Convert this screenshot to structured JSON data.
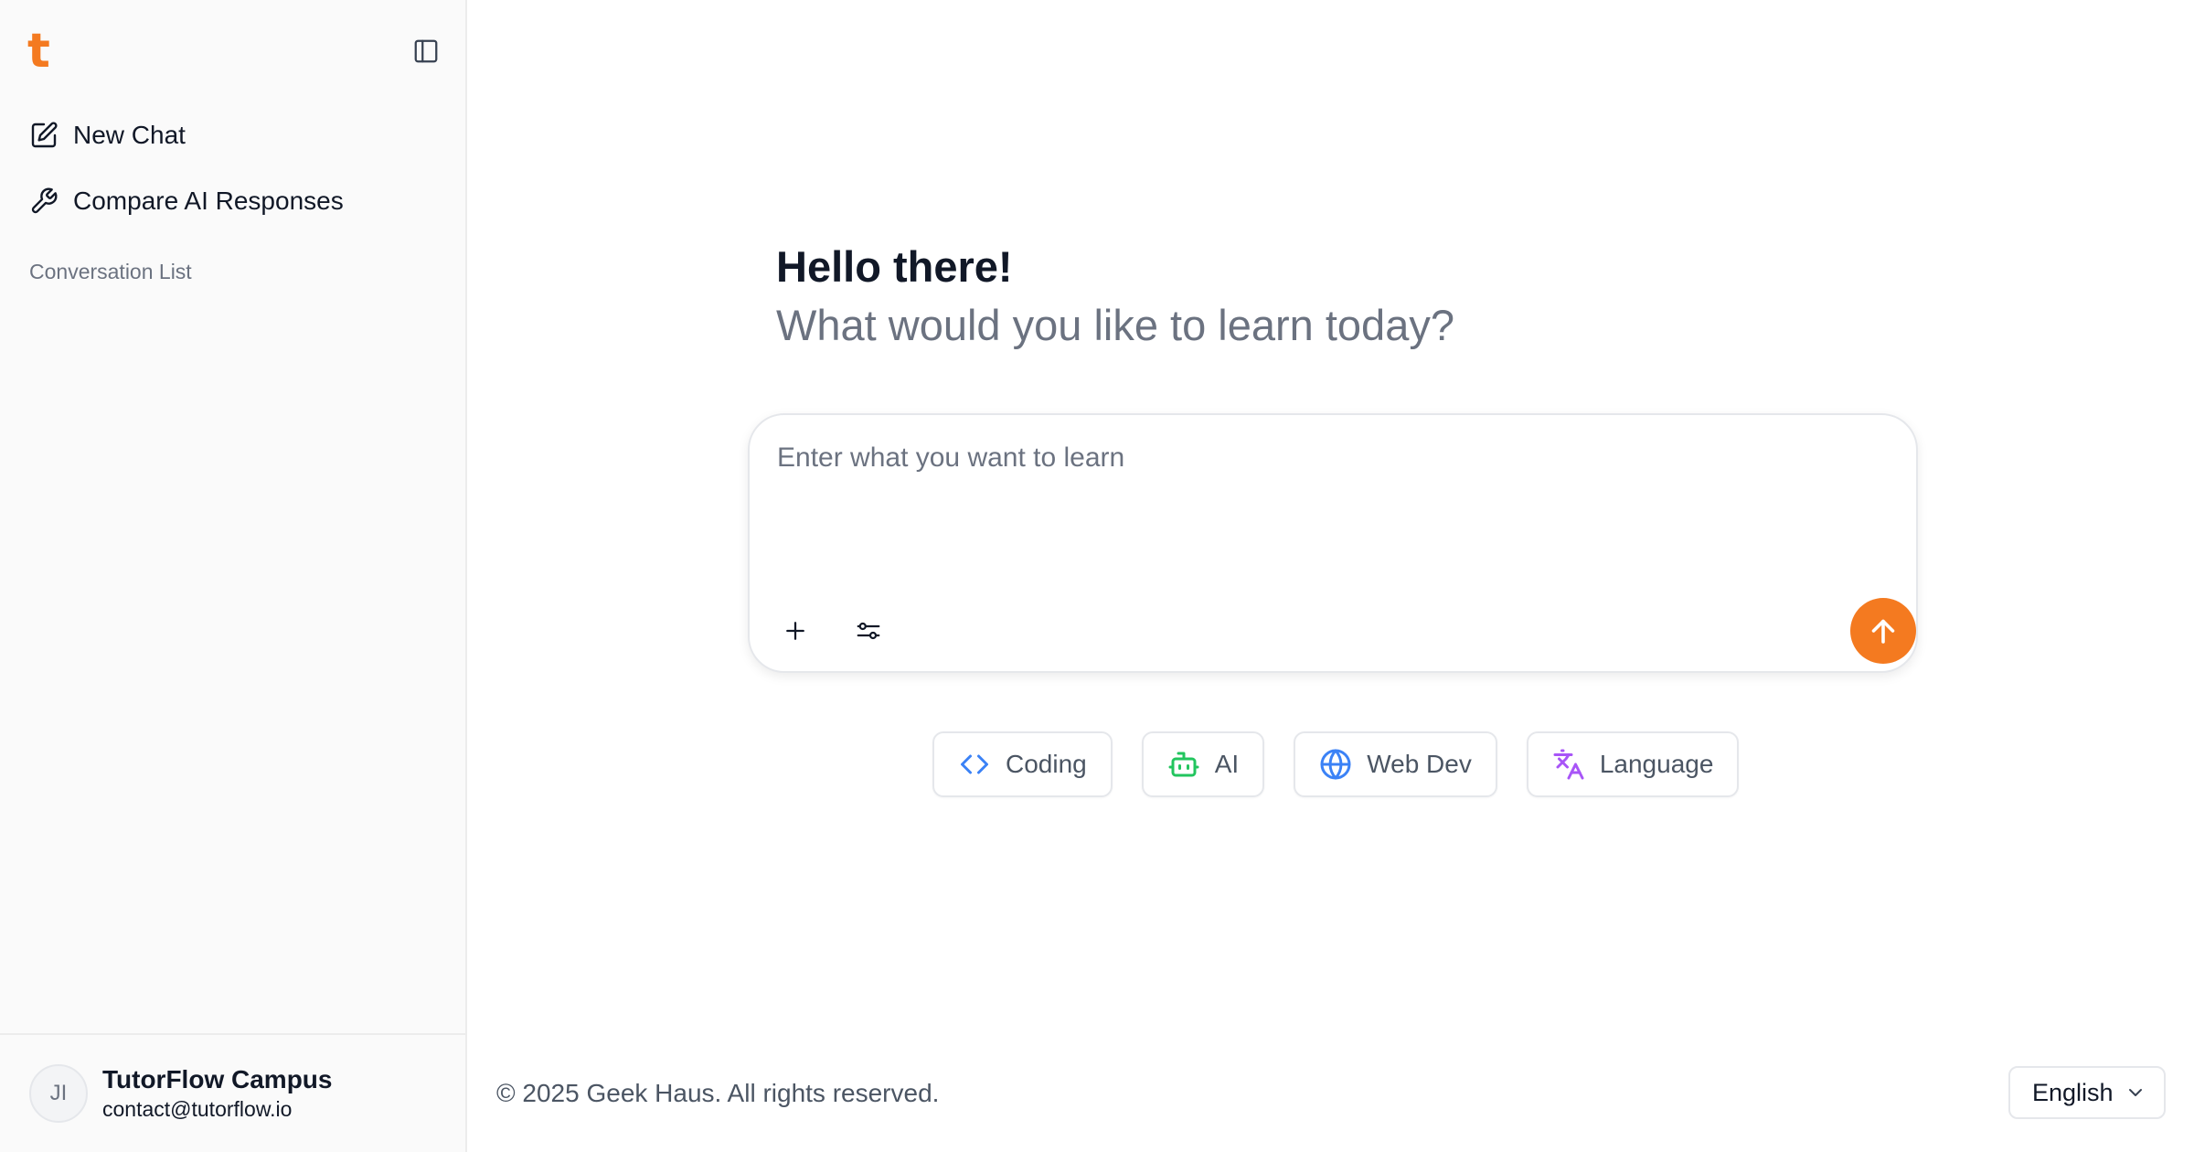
{
  "brand": {
    "logo_letter": "t",
    "accent_color": "#f47a20"
  },
  "sidebar": {
    "toggle_icon": "panel-left-icon",
    "nav": [
      {
        "label": "New Chat",
        "icon": "edit-icon"
      },
      {
        "label": "Compare AI Responses",
        "icon": "wrench-icon"
      }
    ],
    "section_label": "Conversation List",
    "user": {
      "initials": "JI",
      "name": "TutorFlow Campus",
      "email": "contact@tutorflow.io"
    }
  },
  "greeting": {
    "title": "Hello there!",
    "subtitle": "What would you like to learn today?"
  },
  "composer": {
    "placeholder": "Enter what you want to learn",
    "value": "",
    "attach_icon": "plus-icon",
    "settings_icon": "sliders-icon",
    "send_icon": "arrow-up-icon"
  },
  "chips": [
    {
      "label": "Coding",
      "icon": "code-icon",
      "color": "#3b82f6"
    },
    {
      "label": "AI",
      "icon": "bot-icon",
      "color": "#22c55e"
    },
    {
      "label": "Web Dev",
      "icon": "globe-icon",
      "color": "#3b82f6"
    },
    {
      "label": "Language",
      "icon": "translate-icon",
      "color": "#a855f7"
    }
  ],
  "footer": {
    "copyright": "© 2025 Geek Haus. All rights reserved.",
    "language": "English"
  }
}
